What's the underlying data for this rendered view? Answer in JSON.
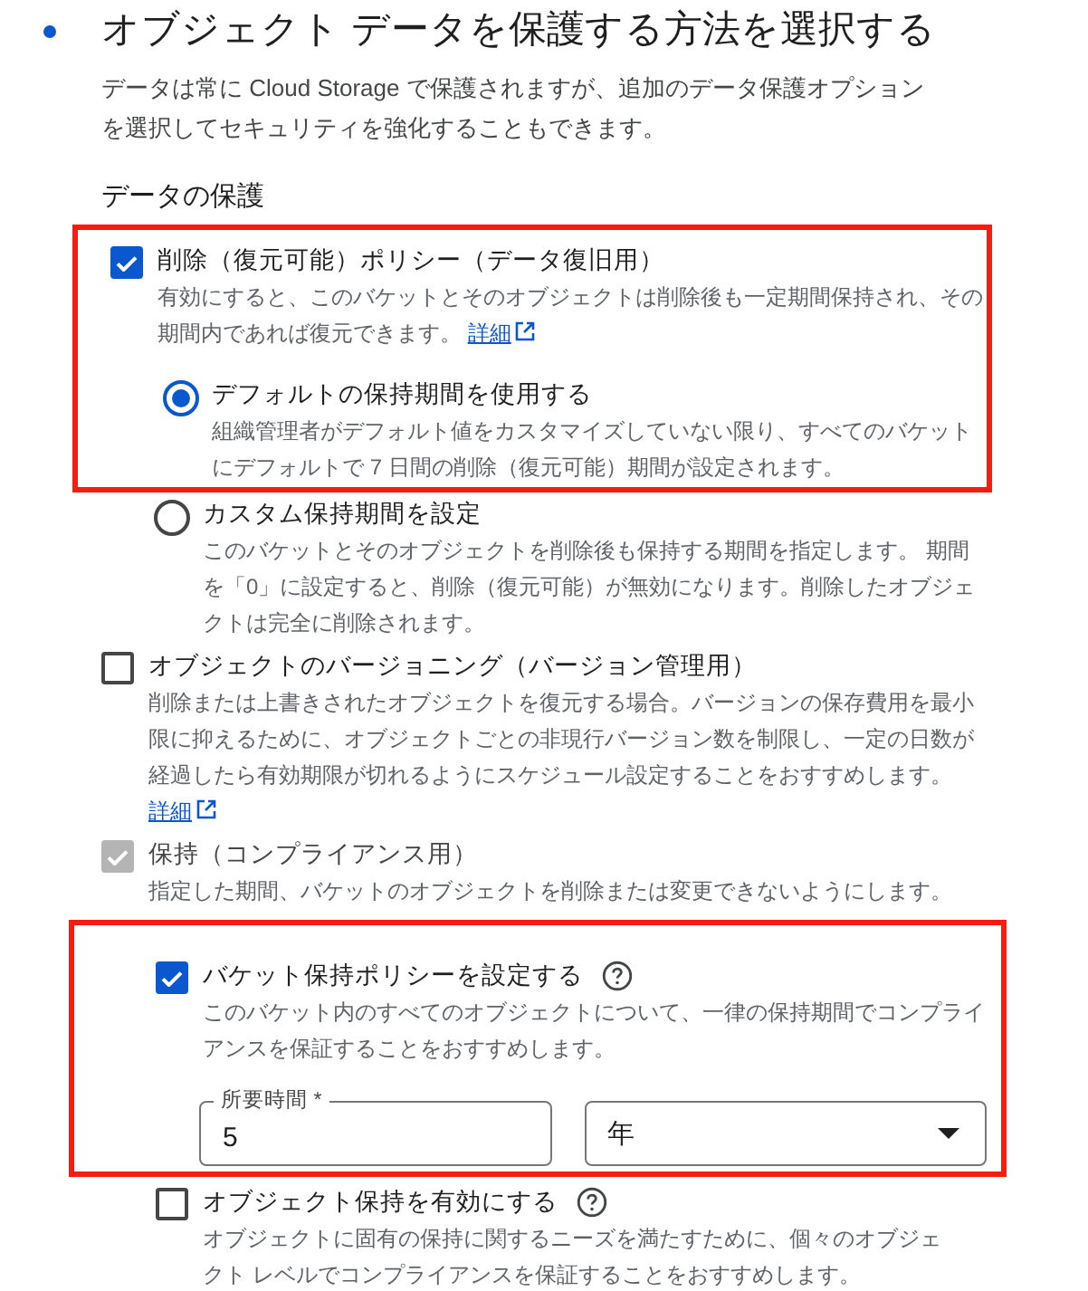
{
  "heading": {
    "title": "オブジェクト データを保護する方法を選択する",
    "intro": "データは常に Cloud Storage で保護されますが、追加のデータ保護オプションを選択してセキュリティを強化することもできます。"
  },
  "section_title": "データの保護",
  "options": [
    {
      "kind": "checkbox",
      "label": "削除（復元可能）ポリシー（データ復旧用）",
      "checked": true,
      "disabled": false,
      "highlighted": true,
      "description": "有効にすると、このバケットとそのオブジェクトは削除後も一定期間保持され、その期間内であれば復元できます。",
      "link": "詳細",
      "children": [
        {
          "kind": "radio",
          "label": "デフォルトの保持期間を使用する",
          "selected": true,
          "highlighted": true,
          "description": "組織管理者がデフォルト値をカスタマイズしていない限り、すべてのバケットにデフォルトで 7 日間の削除（復元可能）期間が設定されます。"
        },
        {
          "kind": "radio",
          "label": "カスタム保持期間を設定",
          "selected": false,
          "highlighted": false,
          "description": "このバケットとそのオブジェクトを削除後も保持する期間を指定します。 期間を「0」に設定すると、削除（復元可能）が無効になります。削除したオブジェクトは完全に削除されます。"
        }
      ]
    },
    {
      "kind": "checkbox",
      "label": "オブジェクトのバージョニング（バージョン管理用）",
      "checked": false,
      "disabled": false,
      "highlighted": false,
      "description": "削除または上書きされたオブジェクトを復元する場合。バージョンの保存費用を最小限に抑えるために、オブジェクトごとの非現行バージョン数を制限し、一定の日数が経過したら有効期限が切れるようにスケジュール設定することをおすすめします。",
      "link": "詳細"
    },
    {
      "kind": "checkbox",
      "label": "保持（コンプライアンス用）",
      "checked": true,
      "disabled": true,
      "highlighted": false,
      "description": "指定した期間、バケットのオブジェクトを削除または変更できないようにします。",
      "children": [
        {
          "kind": "checkbox",
          "label": "バケット保持ポリシーを設定する",
          "help": true,
          "checked": true,
          "disabled": false,
          "highlighted": true,
          "description": "このバケット内のすべてのオブジェクトについて、一律の保持期間でコンプライアンスを保証することをおすすめします。",
          "fields": {
            "duration": {
              "label": "所要時間 *",
              "value": "5"
            },
            "unit": {
              "value": "年"
            }
          }
        },
        {
          "kind": "checkbox",
          "label": "オブジェクト保持を有効にする",
          "help": true,
          "checked": false,
          "disabled": false,
          "highlighted": false,
          "description": "オブジェクトに固有の保持に関するニーズを満たすために、個々のオブジェクト レベルでコンプライアンスを保証することをおすすめします。"
        }
      ]
    }
  ]
}
